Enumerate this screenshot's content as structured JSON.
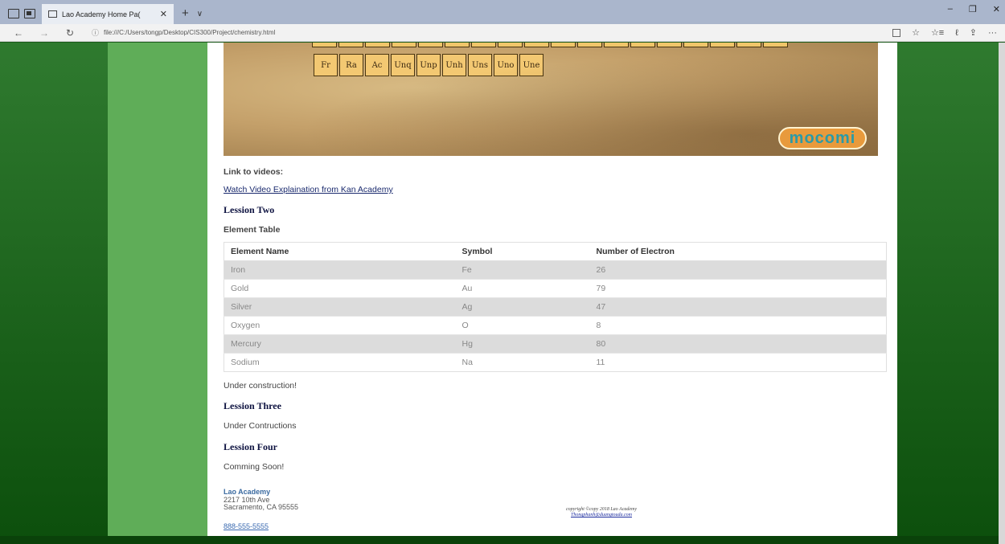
{
  "browser": {
    "tab_title": "Lao Academy Home Pa(",
    "tab_close": "✕",
    "new_tab": "+",
    "tab_menu": "∨",
    "window_controls": {
      "minimize": "–",
      "restore": "❐",
      "close": "✕"
    },
    "nav": {
      "back": "←",
      "forward": "→",
      "refresh": "↻"
    },
    "url_icon": "ⓘ",
    "url": "file:///C:/Users/tongp/Desktop/CIS300/Project/chemistry.html",
    "tools": {
      "favorite": "☆",
      "favorites": "☆≡",
      "notes": "ℓ",
      "share": "⇪",
      "more": "···"
    }
  },
  "banner": {
    "tiles": [
      "Fr",
      "Ra",
      "Ac",
      "Unq",
      "Unp",
      "Unh",
      "Uns",
      "Uno",
      "Une"
    ],
    "logo": "mocomi"
  },
  "content": {
    "videos_label": "Link to videos:",
    "video_link": "Watch Video Explaination from Kan Academy",
    "lesson_two": "Lession Two",
    "element_table_label": "Element Table",
    "table": {
      "headers": [
        "Element Name",
        "Symbol",
        "Number of Electron"
      ],
      "rows": [
        [
          "Iron",
          "Fe",
          "26"
        ],
        [
          "Gold",
          "Au",
          "79"
        ],
        [
          "Silver",
          "Ag",
          "47"
        ],
        [
          "Oxygen",
          "O",
          "8"
        ],
        [
          "Mercury",
          "Hg",
          "80"
        ],
        [
          "Sodium",
          "Na",
          "11"
        ]
      ]
    },
    "under_construction": "Under construction!",
    "lesson_three": "Lession Three",
    "under_contructions": "Under Contructions",
    "lesson_four": "Lession Four",
    "comming_soon": "Comming Soon!"
  },
  "footer": {
    "name": "Lao Academy",
    "address1": "2217 10th Ave",
    "address2": "Sacramento, CA 95555",
    "phone": "888-555-5555",
    "copyright": "copyright ©copy 2018 Lao Academy",
    "email": "Thongphanh@duangtouda.com"
  }
}
